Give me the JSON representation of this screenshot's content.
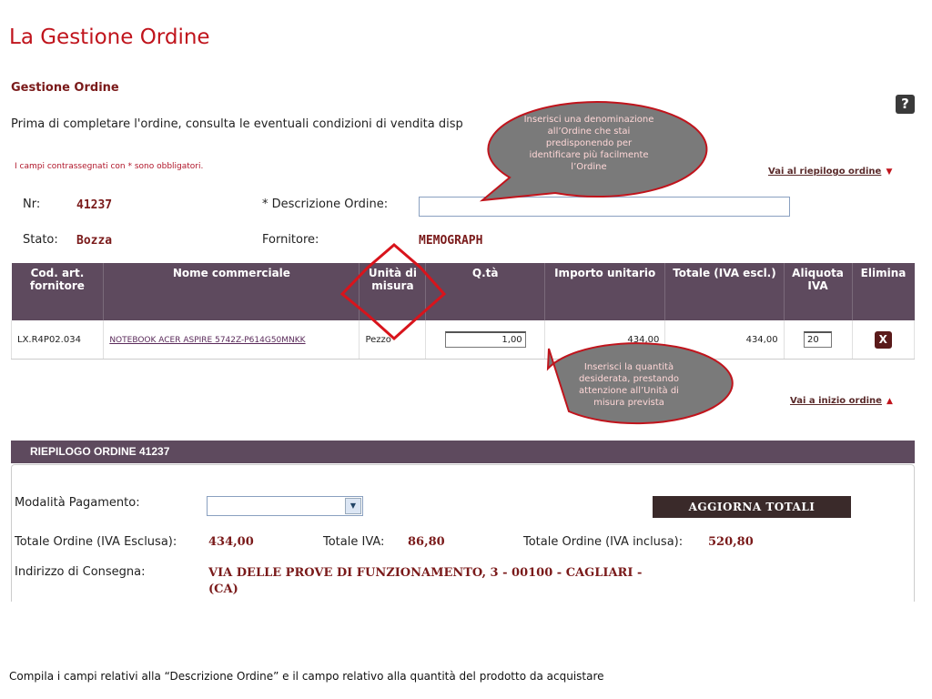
{
  "slide": {
    "title": "La Gestione Ordine",
    "footer": "Compila i campi relativi alla “Descrizione Ordine” e il campo relativo alla quantità del prodotto da acquistare"
  },
  "page": {
    "section_title": "Gestione Ordine",
    "intro_text": "Prima di completare l'ordine, consulta le eventuali condizioni di vendita disp",
    "required_note": "I campi contrassegnati con * sono obbligatori.",
    "link_summary": "Vai al riepilogo ordine",
    "link_top": "Vai a inizio ordine",
    "help_label": "?"
  },
  "order": {
    "nr_label": "Nr:",
    "nr_value": "41237",
    "desc_label": "* Descrizione Ordine:",
    "stato_label": "Stato:",
    "stato_value": "Bozza",
    "fornitore_label": "Fornitore:",
    "fornitore_value": "MEMOGRAPH"
  },
  "table": {
    "headers": {
      "cod": "Cod. art. fornitore",
      "nome": "Nome commerciale",
      "unita": "Unità di misura",
      "qta": "Q.tà",
      "importo": "Importo unitario",
      "totale": "Totale (IVA escl.)",
      "aliquota": "Aliquota IVA",
      "elimina": "Elimina"
    },
    "row": {
      "cod": "LX.R4P02.034",
      "nome": "NOTEBOOK ACER ASPIRE 5742Z-P614G50MNKK",
      "unita": "Pezzo",
      "qta": "1,00",
      "importo": "434,00",
      "totale": "434,00",
      "aliquota": "20",
      "elimina": "X"
    }
  },
  "summary": {
    "title": "RIEPILOGO ORDINE  41237",
    "pagamento_label": "Modalità Pagamento:",
    "update_button": "AGGIORNA  TOTALI",
    "tot_esclusa_label": "Totale Ordine (IVA Esclusa):",
    "tot_esclusa_value": "434,00",
    "tot_iva_label": "Totale IVA:",
    "tot_iva_value": "86,80",
    "tot_inclusa_label": "Totale Ordine (IVA inclusa):",
    "tot_inclusa_value": "520,80",
    "indirizzo_label": "Indirizzo di Consegna:",
    "indirizzo_value": "VIA DELLE PROVE DI FUNZIONAMENTO, 3 - 00100 - CAGLIARI - (CA)"
  },
  "callouts": {
    "desc": "Inserisci una denominazione all’Ordine che stai predisponendo per identificare più facilmente l’Ordine",
    "qty": "Inserisci la quantità desiderata, prestando attenzione all’Unità di misura prevista"
  },
  "colors": {
    "header_bg": "#5e4a5e",
    "accent_red": "#c0141c",
    "callout_fill": "#777777"
  }
}
